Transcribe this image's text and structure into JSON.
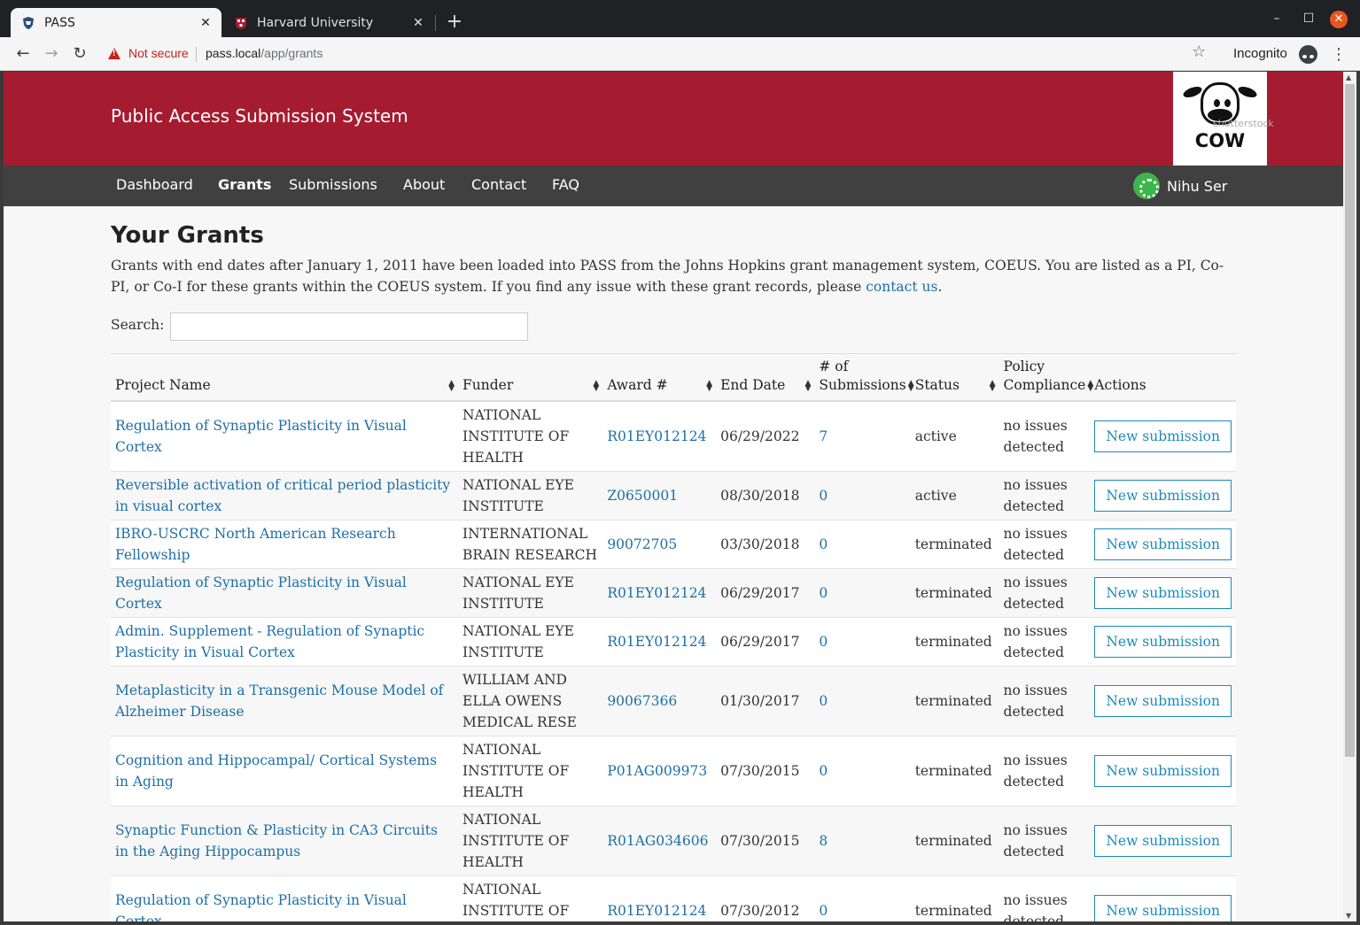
{
  "browser": {
    "tabs": [
      {
        "title": "PASS",
        "active": true
      },
      {
        "title": "Harvard University",
        "active": false
      }
    ],
    "security_label": "Not secure",
    "url_host": "pass.local",
    "url_path": "/app/grants",
    "incognito_label": "Incognito"
  },
  "header": {
    "system_title": "Public Access Submission System",
    "logo_text": "COW",
    "logo_watermark": "shutterstock"
  },
  "nav": {
    "items": [
      "Dashboard",
      "Grants",
      "Submissions",
      "About",
      "Contact",
      "FAQ"
    ],
    "active": "Grants",
    "user_name": "Nihu Ser"
  },
  "page": {
    "title": "Your Grants",
    "intro_text": "Grants with end dates after January 1, 2011 have been loaded into PASS from the Johns Hopkins grant management system, COEUS. You are listed as a PI, Co-PI, or Co-I for these grants within the COEUS system. If you find any issue with these grant records, please ",
    "intro_link": "contact us",
    "intro_end": ".",
    "search_label": "Search:",
    "search_value": ""
  },
  "table": {
    "headers": {
      "project": "Project Name",
      "funder": "Funder",
      "award": "Award #",
      "end_date": "End Date",
      "submissions_1": "# of",
      "submissions_2": "Submissions",
      "status": "Status",
      "policy_1": "Policy",
      "policy_2": "Compliance",
      "actions": "Actions"
    },
    "rows": [
      {
        "project": "Regulation of Synaptic Plasticity in Visual Cortex",
        "funder": "NATIONAL INSTITUTE OF HEALTH",
        "award": "R01EY012124",
        "end_date": "06/29/2022",
        "submissions": "7",
        "status": "active",
        "policy": "no issues detected",
        "action": "New submission"
      },
      {
        "project": "Reversible activation of critical period plasticity in visual cortex",
        "funder": "NATIONAL EYE INSTITUTE",
        "award": "Z0650001",
        "end_date": "08/30/2018",
        "submissions": "0",
        "status": "active",
        "policy": "no issues detected",
        "action": "New submission"
      },
      {
        "project": "IBRO-USCRC North American Research Fellowship",
        "funder": "INTERNATIONAL BRAIN RESEARCH",
        "award": "90072705",
        "end_date": "03/30/2018",
        "submissions": "0",
        "status": "terminated",
        "policy": "no issues detected",
        "action": "New submission"
      },
      {
        "project": "Regulation of Synaptic Plasticity in Visual Cortex",
        "funder": "NATIONAL EYE INSTITUTE",
        "award": "R01EY012124",
        "end_date": "06/29/2017",
        "submissions": "0",
        "status": "terminated",
        "policy": "no issues detected",
        "action": "New submission"
      },
      {
        "project": "Admin. Supplement - Regulation of Synaptic Plasticity in Visual Cortex",
        "funder": "NATIONAL EYE INSTITUTE",
        "award": "R01EY012124",
        "end_date": "06/29/2017",
        "submissions": "0",
        "status": "terminated",
        "policy": "no issues detected",
        "action": "New submission"
      },
      {
        "project": "Metaplasticity in a Transgenic Mouse Model of Alzheimer Disease",
        "funder": "WILLIAM AND ELLA OWENS MEDICAL RESE",
        "award": "90067366",
        "end_date": "01/30/2017",
        "submissions": "0",
        "status": "terminated",
        "policy": "no issues detected",
        "action": "New submission"
      },
      {
        "project": "Cognition and Hippocampal/ Cortical Systems in Aging",
        "funder": "NATIONAL INSTITUTE OF HEALTH",
        "award": "P01AG009973",
        "end_date": "07/30/2015",
        "submissions": "0",
        "status": "terminated",
        "policy": "no issues detected",
        "action": "New submission"
      },
      {
        "project": "Synaptic Function & Plasticity in CA3 Circuits in the Aging Hippocampus",
        "funder": "NATIONAL INSTITUTE OF HEALTH",
        "award": "R01AG034606",
        "end_date": "07/30/2015",
        "submissions": "8",
        "status": "terminated",
        "policy": "no issues detected",
        "action": "New submission"
      },
      {
        "project": "Regulation of Synaptic Plasticity in Visual Cortex",
        "funder": "NATIONAL INSTITUTE OF HEALTH",
        "award": "R01EY012124",
        "end_date": "07/30/2012",
        "submissions": "0",
        "status": "terminated",
        "policy": "no issues detected",
        "action": "New submission"
      }
    ]
  }
}
